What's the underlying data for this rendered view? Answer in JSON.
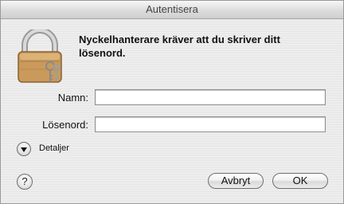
{
  "window": {
    "title": "Autentisera"
  },
  "dialog": {
    "message": "Nyckelhanterare kräver att du skriver ditt lösenord."
  },
  "form": {
    "name_label": "Namn:",
    "name_value": "",
    "password_label": "Lösenord:",
    "password_value": ""
  },
  "details": {
    "label": "Detaljer",
    "expanded": false
  },
  "help": {
    "label": "?"
  },
  "buttons": {
    "cancel": "Avbryt",
    "ok": "OK"
  },
  "icons": {
    "lock": "padlock-with-keys-icon",
    "disclosure": "disclosure-triangle-icon"
  },
  "colors": {
    "lock_body": "#c99a5b",
    "lock_shackle": "#b8b8b8"
  }
}
